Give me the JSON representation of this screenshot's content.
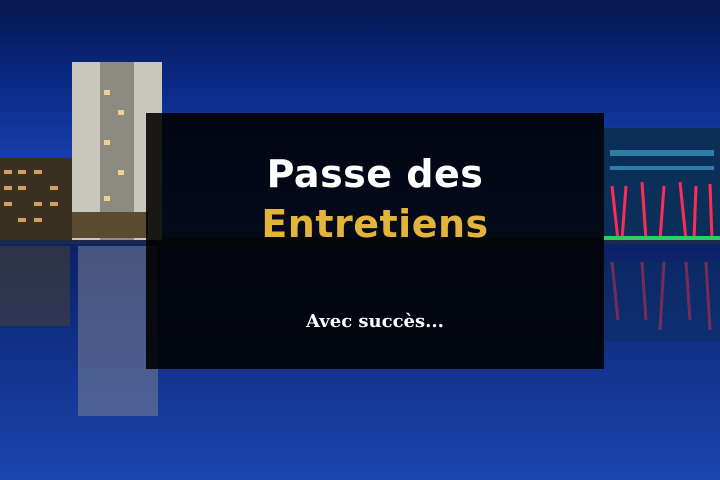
{
  "hero": {
    "title_line1": "Passe des",
    "title_line2": "Entretiens",
    "subtitle": "Avec succès...",
    "title_color": "#ffffff",
    "accent_color": "#e3b43c",
    "overlay_color": "#000000"
  }
}
